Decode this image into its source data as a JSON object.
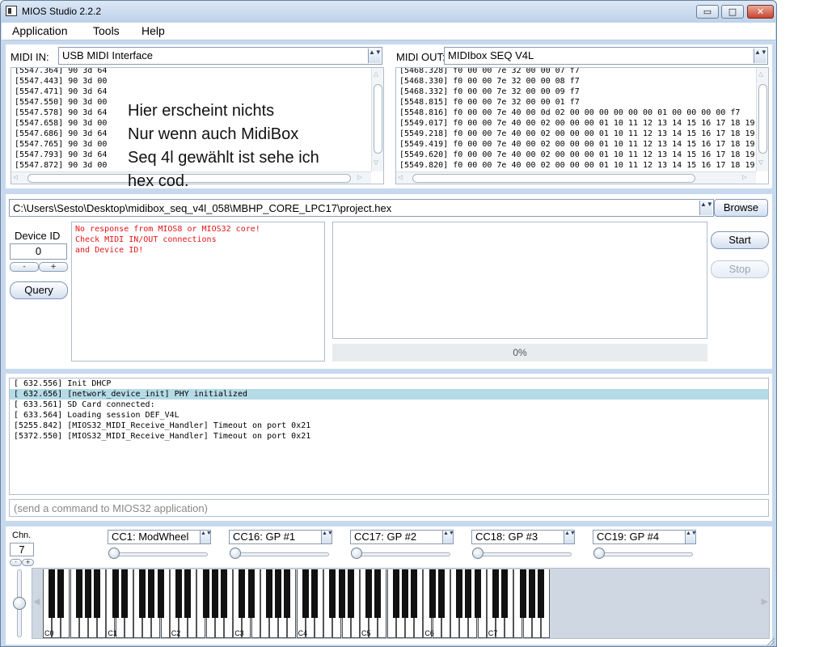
{
  "window": {
    "title": "MIOS Studio 2.2.2",
    "min_glyph": "▭",
    "max_glyph": "□",
    "close_glyph": "✕"
  },
  "menu": [
    "Application",
    "Tools",
    "Help"
  ],
  "midi_in": {
    "label": "MIDI IN:",
    "device": "USB MIDI Interface",
    "lines": [
      "[5547.364] 90 3d 64",
      "[5547.443] 90 3d 00",
      "[5547.471] 90 3d 64",
      "[5547.550] 90 3d 00",
      "[5547.578] 90 3d 64",
      "[5547.658] 90 3d 00",
      "[5547.686] 90 3d 64",
      "[5547.765] 90 3d 00",
      "[5547.793] 90 3d 64",
      "[5547.872] 90 3d 00"
    ]
  },
  "midi_out": {
    "label": "MIDI OUT:",
    "device": "MIDIbox SEQ V4L",
    "lines": [
      "[5468.328] f0 00 00 7e 32 00 00 07 f7",
      "[5468.330] f0 00 00 7e 32 00 00 08 f7",
      "[5468.332] f0 00 00 7e 32 00 00 09 f7",
      "[5548.815] f0 00 00 7e 32 00 00 01 f7",
      "[5548.816] f0 00 00 7e 40 00 0d 02 00 00 00 00 00 00 01 00 00 00 00 f7",
      "[5549.017] f0 00 00 7e 40 00 02 00 00 00 01 10 11 12 13 14 15 16 17 18 19",
      "[5549.218] f0 00 00 7e 40 00 02 00 00 00 01 10 11 12 13 14 15 16 17 18 19",
      "[5549.419] f0 00 00 7e 40 00 02 00 00 00 01 10 11 12 13 14 15 16 17 18 19",
      "[5549.620] f0 00 00 7e 40 00 02 00 00 00 01 10 11 12 13 14 15 16 17 18 19",
      "[5549.820] f0 00 00 7e 40 00 02 00 00 00 01 10 11 12 13 14 15 16 17 18 19"
    ]
  },
  "overlay_note": [
    "Hier erscheint nichts",
    "Nur wenn auch MidiBox",
    "Seq 4l gewählt ist sehe ich",
    "hex cod."
  ],
  "upload": {
    "hex_path": "C:\\Users\\Sesto\\Desktop\\midibox_seq_v4l_058\\MBHP_CORE_LPC17\\project.hex",
    "browse_label": "Browse",
    "device_id_label": "Device ID",
    "device_id_value": "0",
    "dec_label": "-",
    "inc_label": "+",
    "query_label": "Query",
    "response_lines": [
      "No response from MIOS8 or MIOS32 core!",
      "Check MIDI IN/OUT connections",
      "and Device ID!"
    ],
    "start_label": "Start",
    "stop_label": "Stop",
    "progress_text": "0%",
    "progress": 0
  },
  "terminal": {
    "lines": [
      "[ 632.556] Init DHCP",
      "[ 632.656] [network_device_init] PHY initialized",
      "[ 633.561] SD Card connected:",
      "[ 633.564] Loading session DEF_V4L",
      "[5255.842] [MIOS32_MIDI_Receive_Handler] Timeout on port 0x21",
      "[5372.550] [MIOS32_MIDI_Receive_Handler] Timeout on port 0x21"
    ],
    "selected_index": 1,
    "command_placeholder": "(send a command to MIOS32 application)"
  },
  "keyboard": {
    "chn_label": "Chn.",
    "chn_value": "7",
    "chn_dec": "-",
    "chn_inc": "+",
    "cc_controls": [
      {
        "label": "CC1: ModWheel",
        "value": 0
      },
      {
        "label": "CC16: GP #1",
        "value": 0
      },
      {
        "label": "CC17: GP #2",
        "value": 0
      },
      {
        "label": "CC18: GP #3",
        "value": 0
      },
      {
        "label": "CC19: GP #4",
        "value": 0
      }
    ],
    "octave_labels": [
      "C0",
      "C1",
      "C2",
      "C3",
      "C4",
      "C5",
      "C6",
      "C7"
    ],
    "pitch_wheel": 0.5
  },
  "colors": {
    "window_bg": "#c7d9ee",
    "selected_row": "#b5dbe6",
    "error_text": "#e21616"
  },
  "icons": {
    "combo_arrow": "▲▼",
    "scroll_up": "△",
    "scroll_down": "▽",
    "scroll_left": "◁",
    "scroll_right": "▷",
    "kb_left": "◀",
    "kb_right": "▶"
  }
}
